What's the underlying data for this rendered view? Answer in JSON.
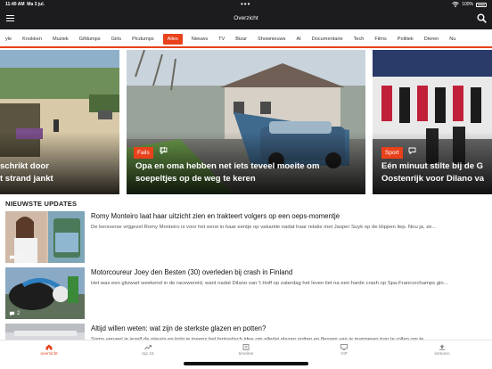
{
  "status_bar": {
    "time": "11:40 AM",
    "date": "Ma 3 jul.",
    "battery": "100%"
  },
  "header": {
    "title": "Overzicht",
    "menu_icon": "hamburger-menu-icon",
    "search_icon": "search-icon"
  },
  "categories": {
    "active": "Alles",
    "items": [
      "yle",
      "Knokken",
      "Muziek",
      "Gifdumps",
      "Girls",
      "Picdumps",
      "Alles",
      "Nieuws",
      "TV",
      "Bizar",
      "Shownieuws",
      "AI",
      "Documentaire",
      "Tech",
      "Films",
      "Politiek",
      "Dieren",
      "Nu"
    ]
  },
  "hero": {
    "slides": [
      {
        "title_line1": "schrikt door",
        "title_line2": "t strand jankt"
      },
      {
        "badge": "Fails",
        "comments": "11",
        "title_line1": "Opa en oma hebben net iets teveel moeite om",
        "title_line2": "soepeltjes op de weg te keren"
      },
      {
        "badge": "Sport",
        "comments": "",
        "title_line1": "Eén minuut stilte bij de G",
        "title_line2": "Oostenrijk voor Dilano va"
      }
    ]
  },
  "section": {
    "title": "NIEUWSTE UPDATES"
  },
  "articles": [
    {
      "title": "Romy Monteiro laat haar uitzicht zien en trakteert volgers op een oeps-momentje",
      "text": "De kersverse vrijgezel Romy Monteiro is voor het eerst in haar eentje op vakantie nadat haar relatie met Jasper Suyk op de klippen liep. Nou ja, ze...",
      "comments": "2"
    },
    {
      "title": "Motorcoureur Joey den Besten (30) overleden bij crash in Finland",
      "text": "Het was een gitzwart weekend in de racewereld, want nadat Dilano van 't Hoff op zaterdag het leven liet na een harde crash op Spa-Francorchamps gin...",
      "comments": "2"
    },
    {
      "title": "Altijd willen weten: wat zijn de sterkste glazen en potten?",
      "text": "Soms verveel ie iezelf de pleuris en krijg ie ineens het fantastisch idee om allerlei glazen potten en flessen van je marmeren trap te rollen om te...",
      "comments": ""
    }
  ],
  "tabbar": {
    "active": "overzicht",
    "tabs": [
      {
        "label": "overzicht",
        "icon": "home-icon"
      },
      {
        "label": "top 15",
        "icon": "trending-icon"
      },
      {
        "label": "timeline",
        "icon": "timeline-icon"
      },
      {
        "label": "VIP",
        "icon": "vip-icon"
      },
      {
        "label": "insturen",
        "icon": "upload-icon"
      }
    ]
  },
  "colors": {
    "accent": "#e8411b",
    "header_bg": "#1c1c1e"
  }
}
